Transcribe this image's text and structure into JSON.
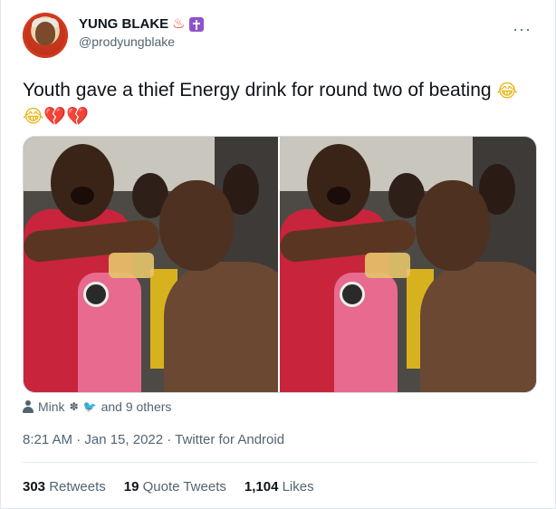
{
  "user": {
    "display_name": "YUNG BLAKE",
    "badge_icons": [
      "hot-springs-icon",
      "latin-cross-icon"
    ],
    "handle": "@prodyungblake"
  },
  "tweet": {
    "text": "Youth gave a thief Energy drink for round two of beating",
    "emojis": [
      "😂",
      "😂",
      "💔",
      "💔"
    ]
  },
  "media": {
    "photo_count": 2
  },
  "likers": {
    "name": "Mink",
    "suffix": "and 9 others"
  },
  "meta": {
    "time": "8:21 AM",
    "date": "Jan 15, 2022",
    "source": "Twitter for Android",
    "line": "8:21 AM · Jan 15, 2022 · Twitter for Android"
  },
  "stats": {
    "retweets_count": "303",
    "retweets_label": "Retweets",
    "quotes_count": "19",
    "quotes_label": "Quote Tweets",
    "likes_count": "1,104",
    "likes_label": "Likes"
  },
  "colors": {
    "text_primary": "#0f1419",
    "text_secondary": "#536471",
    "border": "#e1e8ed"
  }
}
